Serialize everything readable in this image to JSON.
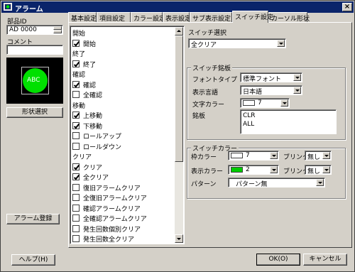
{
  "window": {
    "title": "アラーム",
    "close": "×"
  },
  "left": {
    "part_id_label": "部品ID",
    "part_id_value": "AD 0000",
    "comment_label": "コメント",
    "comment_value": "",
    "preview_text": "ABC",
    "shape_button": "形状選択",
    "register_button": "アラーム登録"
  },
  "tabs": [
    "基本設定",
    "項目設定",
    "カラー設定",
    "表示設定",
    "サブ表示設定",
    "スイッチ設定",
    "カーソル形状"
  ],
  "active_tab": 5,
  "checklist": [
    {
      "type": "cat",
      "label": "開始"
    },
    {
      "type": "item",
      "label": "開始",
      "checked": true
    },
    {
      "type": "cat",
      "label": "終了"
    },
    {
      "type": "item",
      "label": "終了",
      "checked": true
    },
    {
      "type": "cat",
      "label": "確認"
    },
    {
      "type": "item",
      "label": "確認",
      "checked": true
    },
    {
      "type": "item",
      "label": "全確認",
      "checked": false
    },
    {
      "type": "cat",
      "label": "移動"
    },
    {
      "type": "item",
      "label": "上移動",
      "checked": true
    },
    {
      "type": "item",
      "label": "下移動",
      "checked": true
    },
    {
      "type": "item",
      "label": "ロールアップ",
      "checked": false
    },
    {
      "type": "item",
      "label": "ロールダウン",
      "checked": false
    },
    {
      "type": "cat",
      "label": "クリア"
    },
    {
      "type": "item",
      "label": "クリア",
      "checked": true
    },
    {
      "type": "item",
      "label": "全クリア",
      "checked": true
    },
    {
      "type": "item",
      "label": "復旧アラームクリア",
      "checked": false
    },
    {
      "type": "item",
      "label": "全復旧アラームクリア",
      "checked": false
    },
    {
      "type": "item",
      "label": "確認アラームクリア",
      "checked": false
    },
    {
      "type": "item",
      "label": "全確認アラームクリア",
      "checked": false
    },
    {
      "type": "item",
      "label": "発生回数個別クリア",
      "checked": false
    },
    {
      "type": "item",
      "label": "発生回数全クリア",
      "checked": false
    }
  ],
  "switch_select": {
    "label": "スイッチ選択",
    "value": "全クリア"
  },
  "switch_label_group": {
    "title": "スイッチ銘板",
    "font_type_label": "フォントタイプ",
    "font_type_value": "標準フォント",
    "display_lang_label": "表示言語",
    "display_lang_value": "日本語",
    "text_color_label": "文字カラー",
    "text_color_value": "7",
    "text_color_hex": "#ffffff",
    "plate_label": "銘板",
    "plate_line1": "CLR",
    "plate_line2": "ALL"
  },
  "switch_color_group": {
    "title": "スイッチカラー",
    "frame_color_label": "枠カラー",
    "frame_color_value": "7",
    "frame_color_hex": "#ffffff",
    "blink_label_1": "ブリンク",
    "blink_value_1": "無し",
    "display_color_label": "表示カラー",
    "display_color_value": "2",
    "display_color_hex": "#00cc00",
    "blink_label_2": "ブリンク",
    "blink_value_2": "無し",
    "pattern_label": "パターン",
    "pattern_value": "パターン無"
  },
  "footer": {
    "help_button": "ヘルプ(H)",
    "ok_button": "OK(O)",
    "cancel_button": "キャンセル"
  }
}
